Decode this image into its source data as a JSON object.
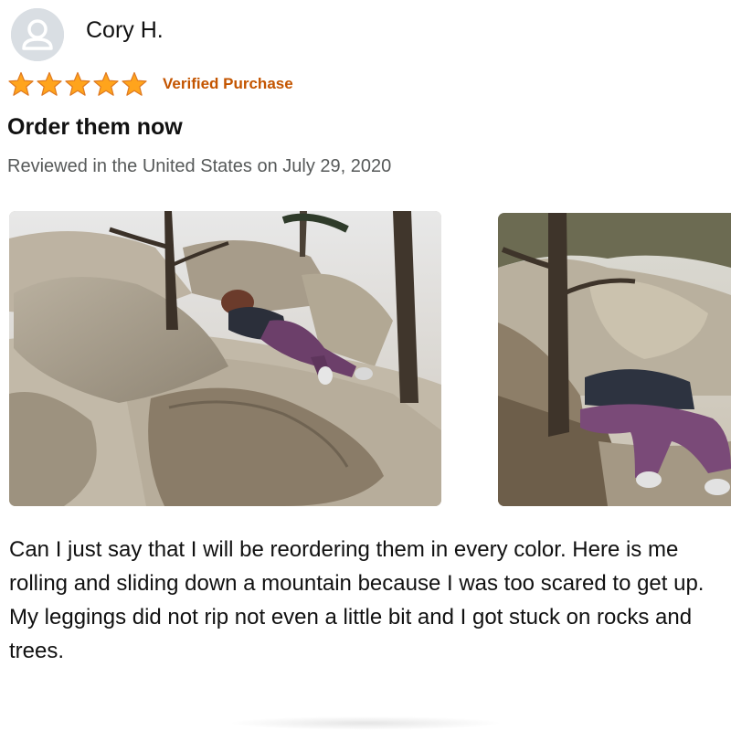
{
  "review": {
    "author": {
      "name": "Cory H.",
      "avatar_icon": "default-user-avatar-icon"
    },
    "rating": {
      "stars": 5,
      "max_stars": 5,
      "star_color": "#ffa41c",
      "star_icon": "star-icon"
    },
    "verified_label": "Verified Purchase",
    "verified_color": "#c45500",
    "title": "Order them now",
    "date_text": "Reviewed in the United States on July 29, 2020",
    "photos": [
      {
        "name": "review-photo-1"
      },
      {
        "name": "review-photo-2"
      }
    ],
    "body": "Can I just say that I will be reordering them in every color. Here is me rolling and sliding down a mountain because I was too scared to get up. My leggings did not rip not even a little bit and I got stuck on rocks and trees."
  }
}
